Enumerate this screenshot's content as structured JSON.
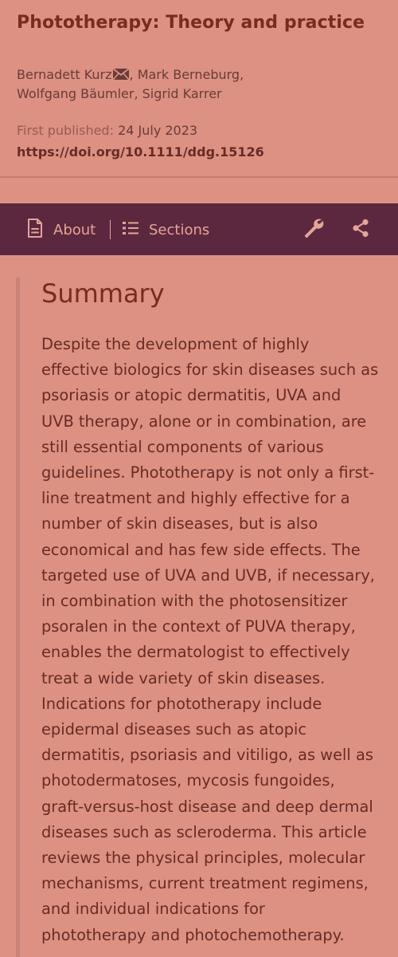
{
  "article": {
    "title": "Phototherapy: Theory and practice",
    "authors": [
      "Bernadett Kurz",
      "Mark Berneburg",
      "Wolfgang Bäumler",
      "Sigrid Karrer"
    ],
    "first_published_label": "First published:",
    "first_published_date": "24 July 2023",
    "doi": "https://doi.org/10.1111/ddg.15126"
  },
  "toolbar": {
    "about_label": "About",
    "sections_label": "Sections",
    "icons": [
      "document-icon",
      "list-icon",
      "wrench-icon",
      "share-icon"
    ]
  },
  "summary": {
    "heading": "Summary",
    "lines": [
      "Despite the development of highly",
      "effective biologics for skin diseases such as",
      "psoriasis or atopic dermatitis, UVA and",
      "UVB therapy, alone or in combination, are",
      "still essential components of various",
      "guidelines. Phototherapy is not only a first-",
      "line treatment and highly effective for a",
      "number of skin diseases, but is also",
      "economical and has few side effects. The",
      "targeted use of UVA and UVB, if necessary,",
      "in combination with the photosensitizer",
      "psoralen in the context of PUVA therapy,",
      "enables the dermatologist to effectively",
      "treat a wide variety of skin diseases.",
      "Indications for phototherapy include",
      "epidermal diseases such as atopic",
      "dermatitis, psoriasis and vitiligo, as well as",
      "photodermatoses, mycosis fungoides,",
      "graft-versus-host disease and deep dermal",
      "diseases such as scleroderma. This article",
      "reviews the physical principles, molecular",
      "mechanisms, current treatment regimens,",
      "and individual indications for",
      "phototherapy and photochemotherapy."
    ]
  },
  "colors": {
    "page_background": "#dc9182",
    "toolbar_background": "#5c2840",
    "toolbar_foreground": "#e4a596",
    "title_color": "#7a2b1e"
  }
}
